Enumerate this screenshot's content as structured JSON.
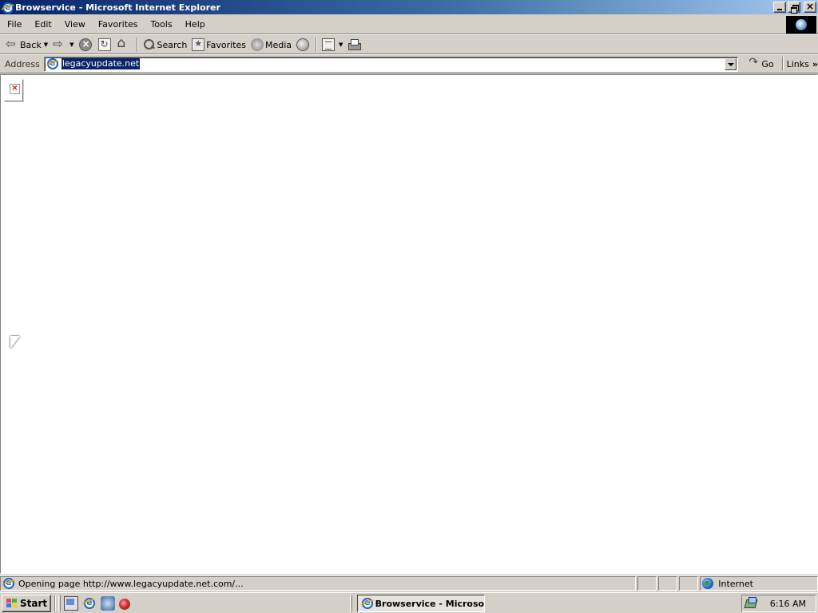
{
  "window": {
    "title": "Browservice - Microsoft Internet Explorer"
  },
  "menu": {
    "items": [
      "File",
      "Edit",
      "View",
      "Favorites",
      "Tools",
      "Help"
    ]
  },
  "toolbar": {
    "back_label": "Back",
    "search_label": "Search",
    "favorites_label": "Favorites",
    "media_label": "Media"
  },
  "address": {
    "label": "Address",
    "value": "legacyupdate.net",
    "go_label": "Go",
    "links_label": "Links"
  },
  "status": {
    "text": "Opening page http://www.legacyupdate.net.com/...",
    "zone": "Internet"
  },
  "taskbar": {
    "start_label": "Start",
    "task_label": "Browservice - Microso...",
    "clock": "6:16 AM"
  }
}
